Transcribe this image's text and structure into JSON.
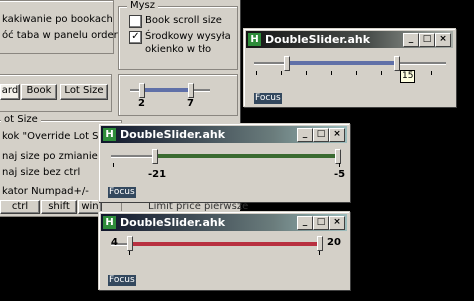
{
  "bg_panel": {
    "mysz_title": "Mysz",
    "row1": "kakiwanie po bookach",
    "row2": "óć taba w panelu order",
    "book_scroll": "Book scroll size",
    "srodkowy_line1": "Środkowy wysyła",
    "srodkowy_line2": "okienko w tło",
    "btn_ard": "ard",
    "btn_book": "Book",
    "btn_lot": "Lot Size",
    "range_min": "2",
    "range_max": "7",
    "lot_size_group": "ot Size",
    "row_override": "kok \"Override Lot Size\"",
    "row_naj1": "naj size po zmianie Lot Size",
    "row_naj2": "naj size bez ctrl",
    "row_numpad": "kator Numpad+/-",
    "btn_ctrl": "ctrl",
    "btn_shift": "shift",
    "btn_win": "win",
    "row_limit": "Limit price pierwsze"
  },
  "win1": {
    "title": "DoubleSlider.ahk",
    "focus": "Focus",
    "tooltip": "15",
    "fill_color": "#6070a8"
  },
  "win2": {
    "title": "DoubleSlider.ahk",
    "focus": "Focus",
    "low_label": "-21",
    "high_label": "-5",
    "fill_color": "#3a6a30"
  },
  "win3": {
    "title": "DoubleSlider.ahk",
    "focus": "Focus",
    "low_label": "4",
    "high_label": "20",
    "fill_color": "#b83040"
  },
  "caption_buttons": {
    "min": "_",
    "max": "□",
    "close": "×"
  }
}
